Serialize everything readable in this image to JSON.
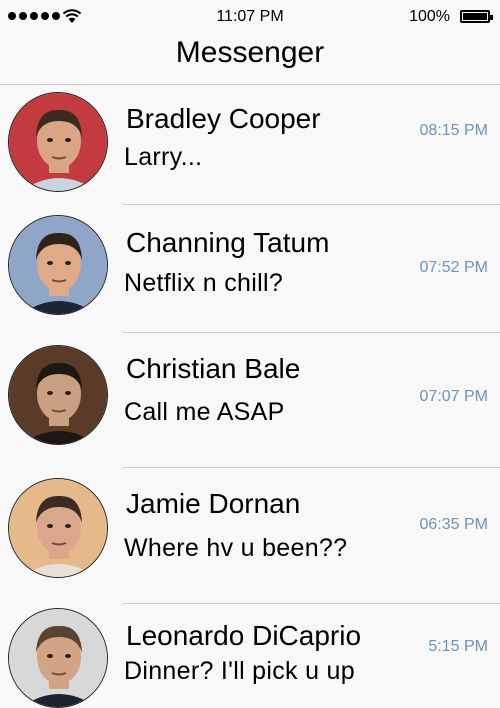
{
  "status_bar": {
    "time": "11:07 PM",
    "battery": "100%",
    "battery_level": 1.0,
    "signal_dots": 5,
    "icons": [
      "signal-dots-icon",
      "wifi-icon",
      "battery-icon"
    ]
  },
  "header": {
    "title": "Messenger"
  },
  "colors": {
    "timestamp": "#6d93b9",
    "background": "#f8f8f8",
    "divider": "#cfcfcf"
  },
  "conversations": [
    {
      "name": "Bradley Cooper",
      "preview": "Larry...",
      "time": "08:15 PM",
      "avatar_bg": "#c33a3f",
      "skin": "#d9a585",
      "hair": "#3b2a20",
      "shirt": "#c9d4dc"
    },
    {
      "name": "Channing Tatum",
      "preview": "Netflix n chill?",
      "time": "07:52 PM",
      "avatar_bg": "#8fa6c8",
      "skin": "#e0aa86",
      "hair": "#2e2219",
      "shirt": "#1d2433"
    },
    {
      "name": "Christian Bale",
      "preview": "Call me ASAP",
      "time": "07:07 PM",
      "avatar_bg": "#5a3b28",
      "skin": "#caa083",
      "hair": "#1f1712",
      "shirt": "#1c1714"
    },
    {
      "name": "Jamie Dornan",
      "preview": "Where hv u been??",
      "time": "06:35 PM",
      "avatar_bg": "#e6b98a",
      "skin": "#d9a88c",
      "hair": "#3a2c22",
      "shirt": "#e8e1d8"
    },
    {
      "name": "Leonardo DiCaprio",
      "preview": "Dinner? I'll pick u up",
      "time": "5:15 PM",
      "avatar_bg": "#d8d8d8",
      "skin": "#d2a384",
      "hair": "#5a4330",
      "shirt": "#1c2230"
    }
  ]
}
